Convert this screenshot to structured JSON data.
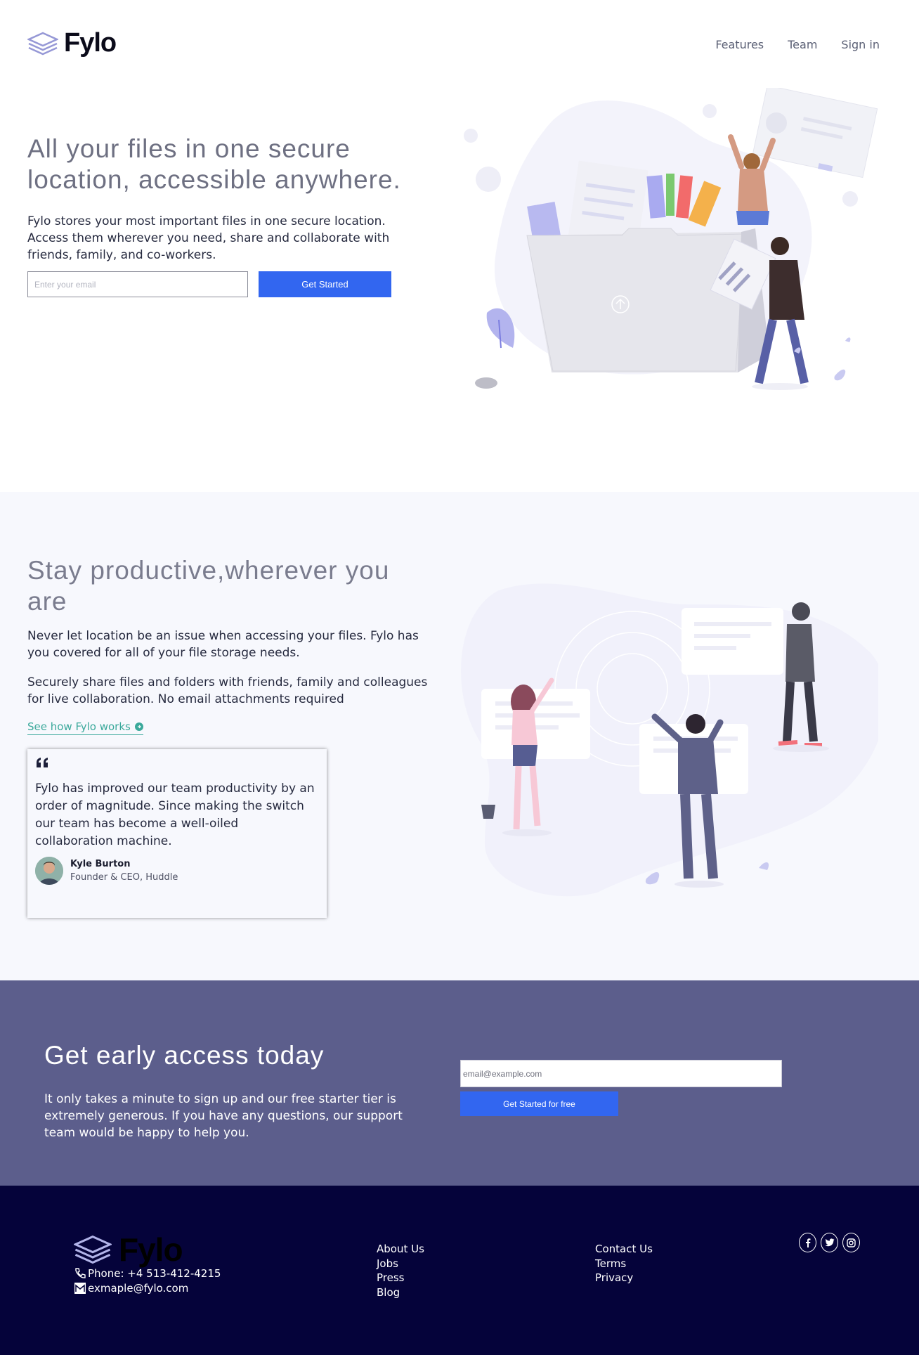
{
  "header": {
    "logo_text": "Fylo",
    "nav": [
      "Features",
      "Team",
      "Sign in"
    ]
  },
  "hero": {
    "title": "All your files in one secure location, accessible anywhere.",
    "text": "Fylo stores your most important files in one secure location. Access them wherever you need, share and collaborate with friends, family, and co-workers.",
    "email_placeholder": "Enter your email",
    "button_label": "Get Started"
  },
  "productive": {
    "title": "Stay productive,wherever you are",
    "p1": "Never let location be an issue when accessing your files. Fylo has you covered for all of your file storage needs.",
    "p2": "Securely share files and folders with friends, family and colleagues for live collaboration. No email attachments required",
    "link_label": "See how Fylo works",
    "testimonial": {
      "quote": "Fylo has improved our team productivity by an order of magnitude. Since making the switch our team has become a well-oiled collaboration machine.",
      "name": "Kyle Burton",
      "role": "Founder & CEO, Huddle"
    }
  },
  "early_access": {
    "title": "Get early access today",
    "text": "It only takes a minute to sign up and our free starter tier is extremely generous. If you have any questions, our support team would be happy to help you.",
    "email_placeholder": "email@example.com",
    "button_label": "Get Started for free"
  },
  "footer": {
    "logo_text": "Fylo",
    "phone": "Phone: +4 513-412-4215",
    "email": "exmaple@fylo.com",
    "col1": [
      "About Us",
      "Jobs",
      "Press",
      "Blog"
    ],
    "col2": [
      "Contact Us",
      "Terms",
      "Privacy"
    ],
    "social_icons": [
      "facebook-icon",
      "twitter-icon",
      "instagram-icon"
    ]
  },
  "colors": {
    "accent_blue": "#3266f0",
    "teal_link": "#3ba99b",
    "early_bg": "#5c5e8c",
    "footer_bg": "#05033a",
    "section_bg": "#f7f8fd"
  }
}
